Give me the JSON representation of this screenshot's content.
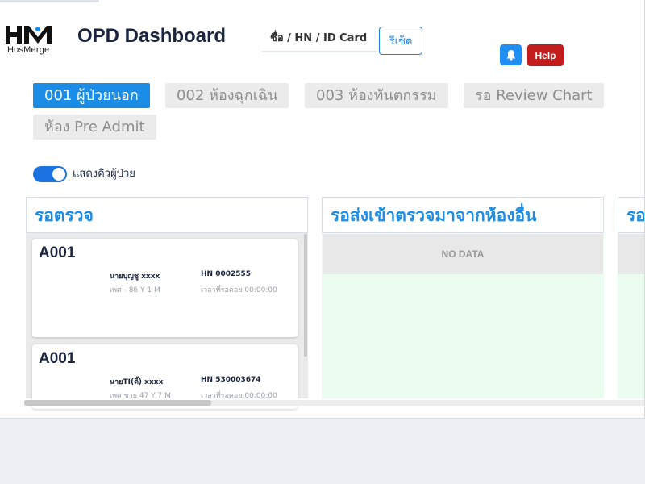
{
  "brand": {
    "logo_text": "HosMerge"
  },
  "header": {
    "title": "OPD Dashboard",
    "search_placeholder": "ชื่อ / HN / ID Card",
    "reset_label": "รีเซ็ต",
    "help_label": "Help"
  },
  "tabs": [
    {
      "label": "001 ผู้ป่วยนอก",
      "active": true
    },
    {
      "label": "002 ห้องฉุกเฉิน",
      "active": false
    },
    {
      "label": "003 ห้องทันตกรรม",
      "active": false
    },
    {
      "label": "รอ Review Chart",
      "active": false
    },
    {
      "label": "ห้อง Pre Admit",
      "active": false
    }
  ],
  "toggle": {
    "label": "แสดงคิวผู้ป่วย",
    "on": true
  },
  "columns": [
    {
      "title": "รอตรวจ"
    },
    {
      "title": "รอส่งเข้าตรวจมาจากห้องอื่น",
      "empty_text": "NO DATA"
    },
    {
      "title": "รอ"
    }
  ],
  "cards": [
    {
      "queue": "A001",
      "name": "นายบุญชู xxxx",
      "hn": "HN 0002555",
      "info": "เพศ - 86 Y 1 M",
      "wait": "เวลาที่รอคอย 00:00:00"
    },
    {
      "queue": "A001",
      "name": "นายTI(ติ้) xxxx",
      "hn": "HN 530003674",
      "info": "เพศ ชาย 47 Y 7 M",
      "wait": "เวลาที่รอคอย 00:00:00"
    }
  ],
  "colors": {
    "accent": "#1c8de6",
    "help": "#c21c1c",
    "empty_column_bg": "#eafdf0"
  }
}
